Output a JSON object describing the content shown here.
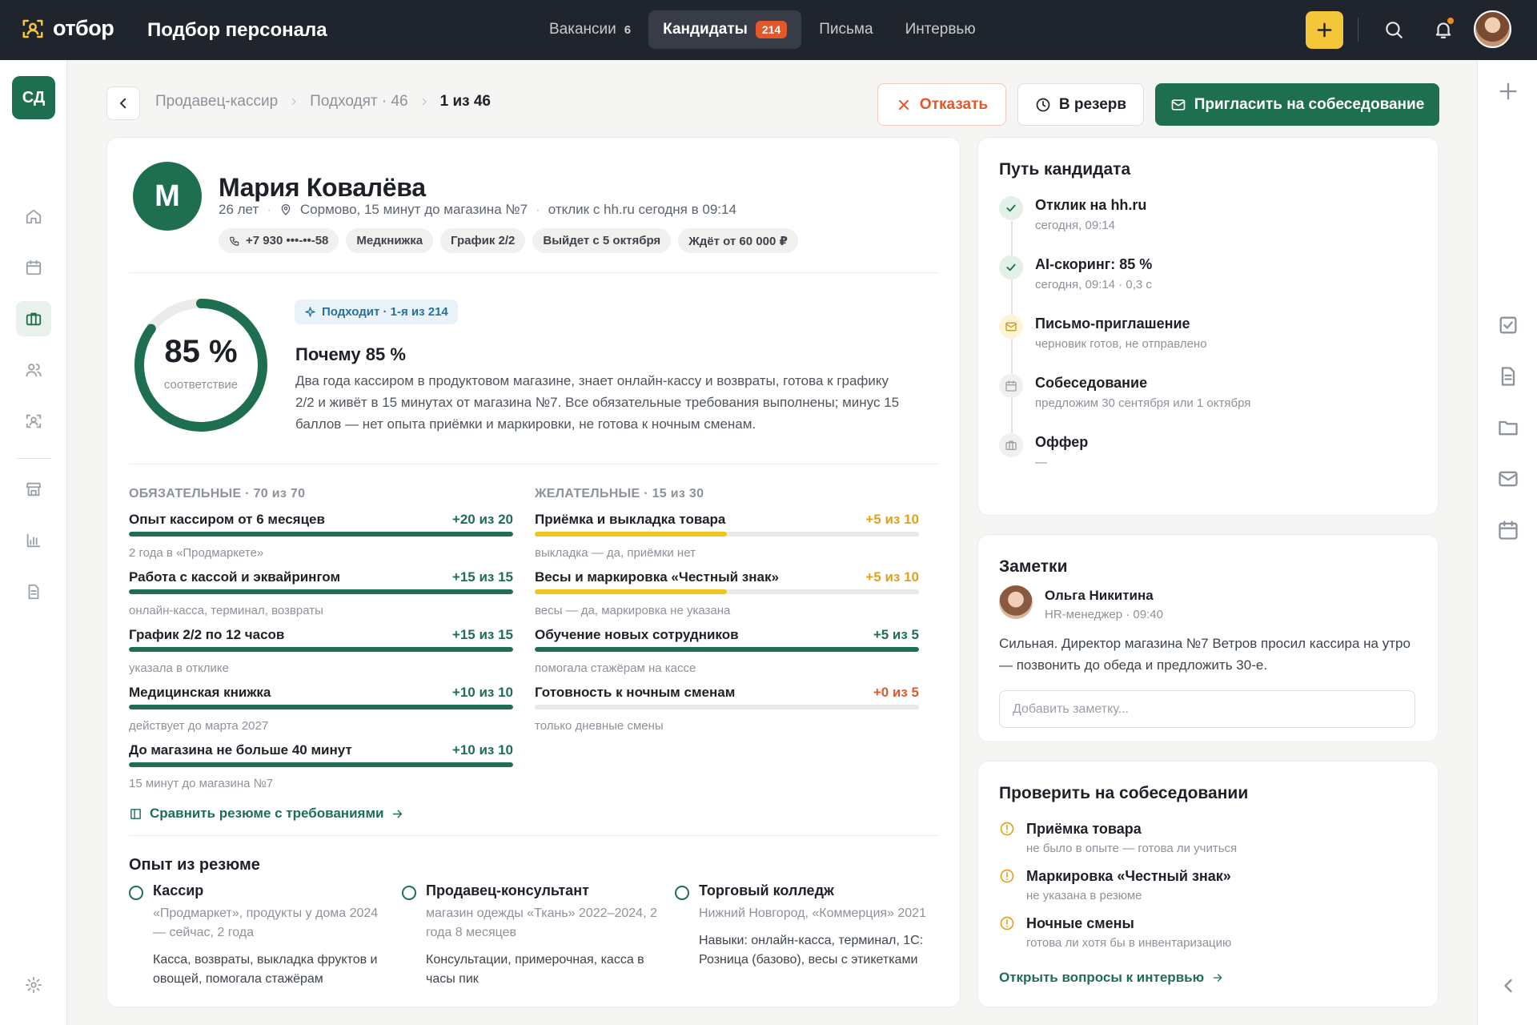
{
  "topbar": {
    "logo": "отбор",
    "app_title": "Подбор персонала",
    "tabs": [
      {
        "label": "Вакансии",
        "count": "6"
      },
      {
        "label": "Кандидаты",
        "count": "214"
      },
      {
        "label": "Письма"
      },
      {
        "label": "Интервью"
      }
    ]
  },
  "sidebar": {
    "org_initials": "СД"
  },
  "breadcrumb": {
    "vacancy": "Продавец-кассир",
    "stage": "Подходят · 46",
    "position": "1 из 46"
  },
  "actions": {
    "reject": "Отказать",
    "reserve": "В резерв",
    "invite": "Пригласить на собеседование"
  },
  "candidate": {
    "initial": "М",
    "name": "Мария Ковалёва",
    "age": "26 лет",
    "location": "Сормово, 15 минут до магазина №7",
    "source": "отклик с hh.ru сегодня в 09:14",
    "chips": [
      "+7 930 •••-••-58",
      "Медкнижка",
      "График 2/2",
      "Выйдет с 5 октября",
      "Ждёт от 60 000 ₽"
    ]
  },
  "score": {
    "value": 85,
    "value_label": "85 %",
    "label": "соответствие",
    "fit_chip": "Подходит · 1-я из 214",
    "why_title": "Почему 85 %",
    "why_text": "Два года кассиром в продуктовом магазине, знает онлайн-кассу и возвраты, готова к графику 2/2 и живёт в 15 минутах от магазина №7. Все обязательные требования выполнены; минус 15 баллов — нет опыта приёмки и маркировки, не готова к ночным сменам."
  },
  "requirements": {
    "mandatory_title": "ОБЯЗАТЕЛЬНЫЕ · 70 из 70",
    "mandatory": [
      {
        "name": "Опыт кассиром от 6 месяцев",
        "score": "+20 из 20",
        "fill": 1.0,
        "note": "2 года в «Продмаркете»"
      },
      {
        "name": "Работа с кассой и эквайрингом",
        "score": "+15 из 15",
        "fill": 1.0,
        "note": "онлайн-касса, терминал, возвраты"
      },
      {
        "name": "График 2/2 по 12 часов",
        "score": "+15 из 15",
        "fill": 1.0,
        "note": "указала в отклике"
      },
      {
        "name": "Медицинская книжка",
        "score": "+10 из 10",
        "fill": 1.0,
        "note": "действует до марта 2027"
      },
      {
        "name": "До магазина не больше 40 минут",
        "score": "+10 из 10",
        "fill": 1.0,
        "note": "15 минут до магазина №7"
      }
    ],
    "optional_title": "ЖЕЛАТЕЛЬНЫЕ · 15 из 30",
    "optional": [
      {
        "name": "Приёмка и выкладка товара",
        "score": "+5 из 10",
        "fill": 0.5,
        "note": "выкладка — да, приёмки нет"
      },
      {
        "name": "Весы и маркировка «Честный знак»",
        "score": "+5 из 10",
        "fill": 0.5,
        "note": "весы — да, маркировка не указана"
      },
      {
        "name": "Обучение новых сотрудников",
        "score": "+5 из 5",
        "fill": 1.0,
        "note": "помогала стажёрам на кассе"
      },
      {
        "name": "Готовность к ночным сменам",
        "score": "+0 из 5",
        "fill": 0.0,
        "note": "только дневные смены"
      }
    ],
    "compare_link": "Сравнить резюме с требованиями"
  },
  "experience": {
    "title": "Опыт из резюме",
    "items": [
      {
        "role": "Кассир",
        "sub": "«Продмаркет», продукты у дома 2024 — сейчас, 2 года",
        "desc": "Касса, возвраты, выкладка фруктов и овощей, помогала стажёрам"
      },
      {
        "role": "Продавец-консультант",
        "sub": "магазин одежды «Ткань» 2022–2024, 2 года 8 месяцев",
        "desc": "Консультации, примерочная, касса в часы пик"
      },
      {
        "role": "Торговый колледж",
        "sub": "Нижний Новгород, «Коммерция» 2021",
        "desc": "Навыки: онлайн-касса, терминал, 1С: Розница (базово), весы с этикетками"
      }
    ]
  },
  "path": {
    "title": "Путь кандидата",
    "steps": [
      {
        "title": "Отклик на hh.ru",
        "sub": "сегодня, 09:14",
        "state": "done"
      },
      {
        "title": "AI-скоринг: 85 %",
        "sub": "сегодня, 09:14 · 0,3 с",
        "state": "done"
      },
      {
        "title": "Письмо-приглашение",
        "sub": "черновик готов, не отправлено",
        "state": "pending"
      },
      {
        "title": "Собеседование",
        "sub": "предложим 30 сентября или 1 октября",
        "state": "todo"
      },
      {
        "title": "Оффер",
        "sub": "—",
        "state": "todo"
      }
    ]
  },
  "notes": {
    "title": "Заметки",
    "author": "Ольга Никитина",
    "role": "HR-менеджер · 09:40",
    "text": "Сильная. Директор магазина №7 Ветров просил кассира на утро — позвонить до обеда и предложить 30-е.",
    "placeholder": "Добавить заметку..."
  },
  "checks": {
    "title": "Проверить на собеседовании",
    "items": [
      {
        "title": "Приёмка товара",
        "sub": "не было в опыте — готова ли учиться"
      },
      {
        "title": "Маркировка «Честный знак»",
        "sub": "не указана в резюме"
      },
      {
        "title": "Ночные смены",
        "sub": "готова ли хотя бы в инвентаризацию"
      }
    ],
    "link": "Открыть вопросы к интервью"
  },
  "colors": {
    "brand": "#1e6f4f",
    "accent": "#f4c63a",
    "danger": "#e2582b",
    "warning": "#f2c318",
    "topbar": "#20242c"
  }
}
